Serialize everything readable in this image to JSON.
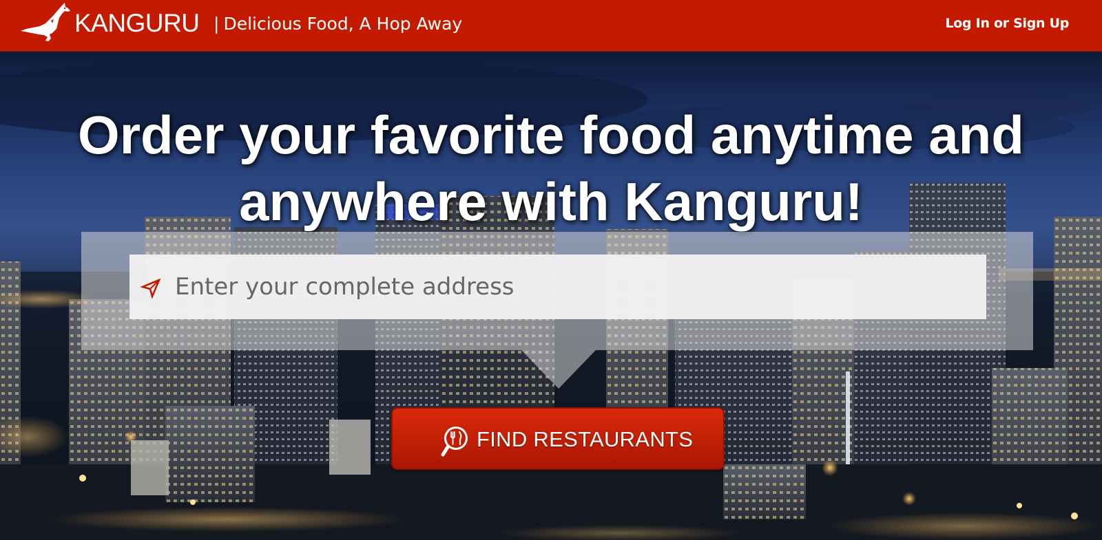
{
  "header": {
    "brand_name": "KANGURU",
    "tagline_separator": "|",
    "tagline": "Delicious Food, A Hop Away",
    "login_label": "Log In or Sign Up",
    "background_color": "#c41a00"
  },
  "hero": {
    "headline_line1": "Order your favorite food anytime and",
    "headline_line2": "anywhere with Kanguru!"
  },
  "search": {
    "placeholder": "Enter your complete address",
    "value": "",
    "icon": "location-arrow-icon"
  },
  "find_button": {
    "label": "FIND RESTAURANTS",
    "icon": "magnifier-fork-knife-icon",
    "color": "#c41a00"
  }
}
